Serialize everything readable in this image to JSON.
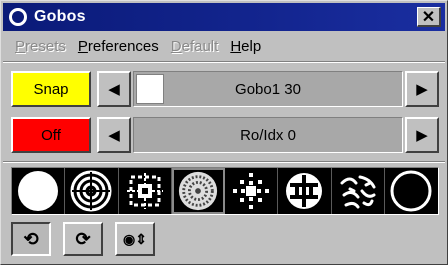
{
  "window": {
    "title": "Gobos"
  },
  "menu": {
    "items": [
      {
        "label_mn": "P",
        "label_rest": "resets",
        "enabled": false
      },
      {
        "label_mn": "P",
        "label_rest": "references",
        "enabled": true
      },
      {
        "label_mn": "D",
        "label_rest": "efault",
        "enabled": false
      },
      {
        "label_mn": "H",
        "label_rest": "elp",
        "enabled": true
      }
    ]
  },
  "row1": {
    "button_label": "Snap",
    "button_color": "#ffff00",
    "field_value": "Gobo1 30",
    "left_arrow": "◀",
    "right_arrow": "▶"
  },
  "row2": {
    "button_label": "Off",
    "button_color": "#ff0000",
    "field_value": "Ro/Idx 0",
    "left_arrow": "◀",
    "right_arrow": "▶"
  },
  "gobos": [
    {
      "icon": "solid-circle-gobo-icon",
      "selected": false
    },
    {
      "icon": "concentric-spiral-gobo-icon",
      "selected": false
    },
    {
      "icon": "star-lattice-gobo-icon",
      "selected": false
    },
    {
      "icon": "dotted-swirl-gobo-icon",
      "selected": true
    },
    {
      "icon": "sparkle-dots-gobo-icon",
      "selected": false
    },
    {
      "icon": "cross-pattern-gobo-icon",
      "selected": false
    },
    {
      "icon": "leaf-breakup-gobo-icon",
      "selected": false
    },
    {
      "icon": "ring-gobo-icon",
      "selected": false
    }
  ],
  "tools": [
    {
      "icon": "rotate-left-icon",
      "symbol": "⟲",
      "pressed": true
    },
    {
      "icon": "rotate-right-icon",
      "symbol": "⟳",
      "pressed": false
    },
    {
      "icon": "index-shake-icon",
      "symbol": "◉⇕",
      "pressed": false
    }
  ],
  "colors": {
    "title_bar": "#0a1a78",
    "face": "#c0c0c0",
    "field": "#a8a8a8"
  }
}
